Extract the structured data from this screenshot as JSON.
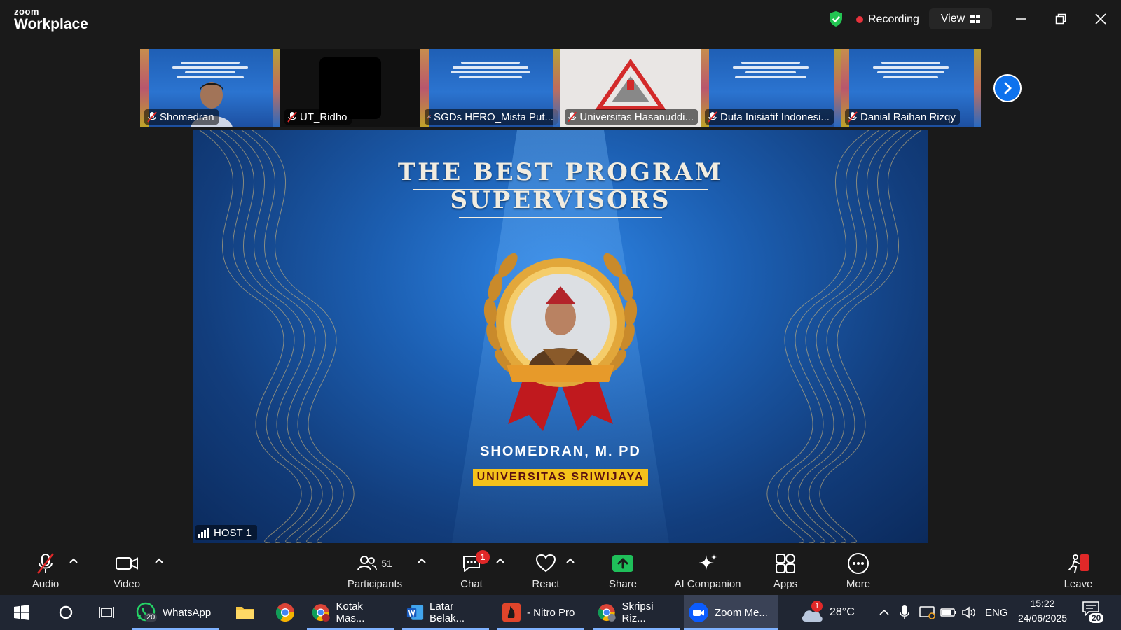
{
  "app": {
    "brand_top": "zoom",
    "brand_bottom": "Workplace"
  },
  "titlebar": {
    "recording_label": "Recording",
    "view_label": "View"
  },
  "participants_strip": [
    {
      "name": "Shomedran",
      "type": "slide-person"
    },
    {
      "name": "UT_Ridho",
      "type": "dark"
    },
    {
      "name": "SGDs HERO_Mista Put...",
      "type": "slide"
    },
    {
      "name": "Universitas Hasanuddi...",
      "type": "university"
    },
    {
      "name": "Duta Inisiatif Indonesi...",
      "type": "slide"
    },
    {
      "name": "Danial Raihan Rizqy",
      "type": "slide"
    }
  ],
  "share": {
    "title_line1": "THE BEST PROGRAM",
    "title_line2": "SUPERVISORS",
    "winner_name": "SHOMEDRAN, M. PD",
    "university": "UNIVERSITAS SRIWIJAYA",
    "host_label": "HOST 1"
  },
  "toolbar": {
    "audio": "Audio",
    "video": "Video",
    "participants": "Participants",
    "participants_count": "51",
    "chat": "Chat",
    "chat_badge": "1",
    "react": "React",
    "share": "Share",
    "ai_companion": "AI Companion",
    "apps": "Apps",
    "more": "More",
    "leave": "Leave"
  },
  "taskbar": {
    "items": [
      {
        "label": "WhatsApp",
        "badge": "20"
      },
      {
        "label": "Kotak Mas..."
      },
      {
        "label": "Latar Belak..."
      },
      {
        "label": "- Nitro Pro"
      },
      {
        "label": "Skripsi Riz..."
      },
      {
        "label": "Zoom Me..."
      }
    ],
    "weather_temp": "28°C",
    "weather_badge": "1",
    "language": "ENG",
    "time": "15:22",
    "date": "24/06/2025",
    "notification_count": "20"
  },
  "colors": {
    "accent": "#0e72ed",
    "recording": "#e8323c",
    "share_green": "#1fbf5a",
    "leave_red": "#e02828"
  }
}
